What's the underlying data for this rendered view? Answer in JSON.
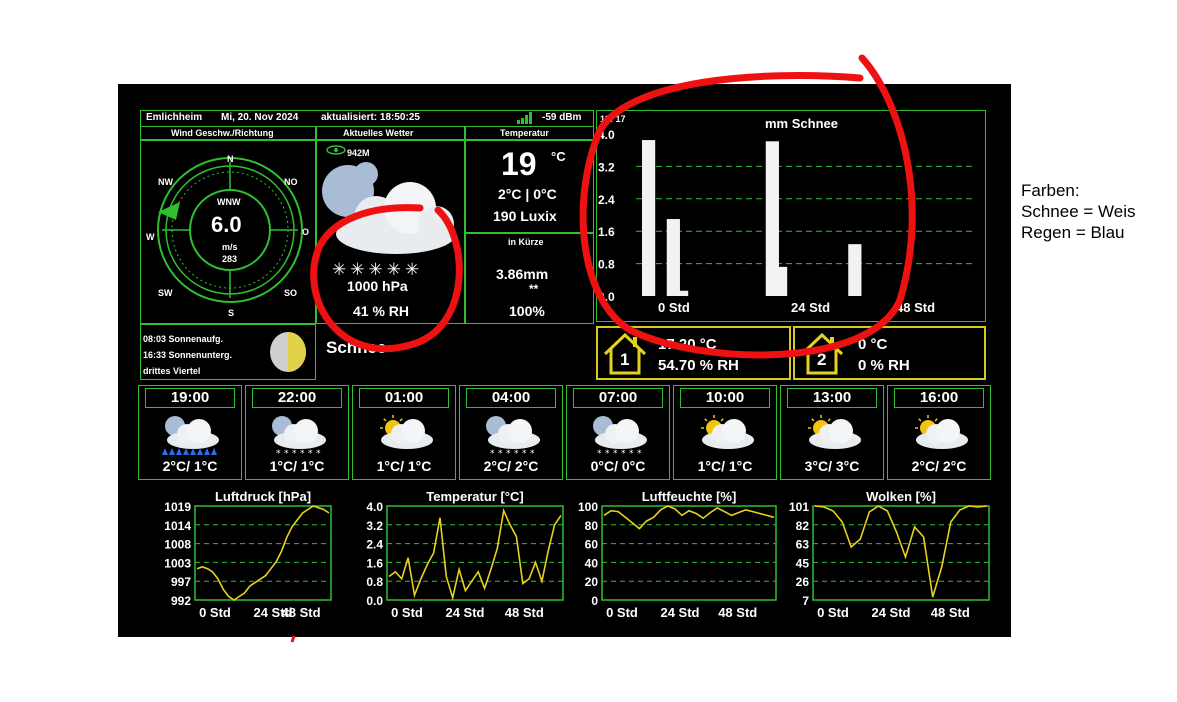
{
  "header": {
    "location": "Emlichheim",
    "date": "Mi, 20. Nov 2024",
    "updated": "aktualisiert: 18:50:25",
    "signal": "-59 dBm"
  },
  "wind": {
    "title": "Wind Geschw./Richtung",
    "n": "N",
    "no": "NO",
    "o": "O",
    "so": "SO",
    "s": "S",
    "sw": "SW",
    "w": "W",
    "nw": "NW",
    "dir": "WNW",
    "speed": "6.0",
    "unit": "m/s",
    "degrees": "283"
  },
  "current": {
    "title": "Aktuelles Wetter",
    "visibility": "942M",
    "snowflakes": "✳✳✳✳✳",
    "pressure": "1000 hPa",
    "humidity": "41 % RH",
    "condition": "Schnee"
  },
  "temperature": {
    "title": "Temperatur",
    "value": "19",
    "unit": "°C",
    "minmax": "2°C | 0°C",
    "lux": "190 Luxix"
  },
  "shortly": {
    "title": "in Kürze",
    "precip": "3.86mm",
    "symbol": "**",
    "probability": "100%"
  },
  "sun": {
    "sunrise": "08:03 Sonnenaufg.",
    "sunset": "16:33 Sonnenunterg.",
    "moon": "drittes Viertel"
  },
  "snow_chart_box": {
    "corner": "19:  17",
    "title": "mm Schnee"
  },
  "chart_data": [
    {
      "type": "bar",
      "title": "mm Schnee",
      "ylim": [
        0,
        4.0
      ],
      "yticks": [
        "4.0",
        "3.2",
        "2.4",
        "1.6",
        "0.8",
        "0.0"
      ],
      "xticks": [
        "0 Std",
        "24 Std",
        "48 Std"
      ],
      "values": [
        3.85,
        0,
        0,
        1.9,
        0.13,
        0,
        0,
        0,
        0,
        0,
        0,
        0,
        0,
        0,
        0,
        3.82,
        0.72,
        0,
        0,
        0,
        0,
        0,
        0,
        0,
        0,
        1.28,
        0,
        0,
        0,
        0,
        0,
        0,
        0,
        0,
        0,
        0,
        0,
        0,
        0,
        0
      ],
      "grid": true
    },
    {
      "type": "line",
      "title": "Luftdruck [hPa]",
      "yticks": [
        "1019",
        "1014",
        "1008",
        "1003",
        "997",
        "992"
      ],
      "ylim": [
        992,
        1019
      ],
      "xticks": [
        "0 Std",
        "24 Std",
        "48 Std"
      ],
      "values": [
        1001,
        1001.5,
        1001,
        1000,
        998,
        995,
        993,
        992,
        993,
        994,
        996,
        997,
        998,
        999,
        1001,
        1003,
        1006,
        1010,
        1013,
        1015,
        1017,
        1018,
        1019,
        1018.5,
        1018,
        1017
      ]
    },
    {
      "type": "line",
      "title": "Temperatur [°C]",
      "yticks": [
        "4.0",
        "3.2",
        "2.4",
        "1.6",
        "0.8",
        "0.0"
      ],
      "ylim": [
        0,
        4.0
      ],
      "xticks": [
        "0 Std",
        "24 Std",
        "48 Std"
      ],
      "values": [
        1.0,
        1.2,
        0.9,
        1.8,
        0.2,
        0.9,
        1.5,
        2.0,
        3.5,
        1.0,
        0.1,
        1.3,
        0.4,
        0.8,
        1.2,
        0.5,
        1.3,
        2.2,
        3.8,
        3.2,
        2.7,
        0.7,
        0.9,
        1.6,
        0.8,
        2.1,
        3.2,
        3.6
      ]
    },
    {
      "type": "line",
      "title": "Luftfeuchte [%]",
      "yticks": [
        "100",
        "80",
        "60",
        "40",
        "20",
        "0"
      ],
      "ylim": [
        0,
        100
      ],
      "xticks": [
        "0 Std",
        "24 Std",
        "48 Std"
      ],
      "values": [
        90,
        95,
        94,
        88,
        82,
        76,
        84,
        88,
        96,
        100,
        97,
        90,
        95,
        92,
        87,
        93,
        98,
        94,
        90,
        93,
        96,
        94,
        92,
        90,
        88
      ]
    },
    {
      "type": "line",
      "title": "Wolken [%]",
      "yticks": [
        "101",
        "82",
        "63",
        "45",
        "26",
        "7"
      ],
      "ylim": [
        7,
        101
      ],
      "xticks": [
        "0 Std",
        "24 Std",
        "48 Std"
      ],
      "values": [
        101,
        100,
        96,
        85,
        60,
        68,
        95,
        101,
        96,
        75,
        50,
        80,
        70,
        10,
        40,
        85,
        97,
        101,
        100,
        101
      ]
    }
  ],
  "indoor1": {
    "number": "1",
    "temp": "17.20 °C",
    "humidity": "54.70 % RH"
  },
  "indoor2": {
    "number": "2",
    "temp": "0 °C",
    "humidity": "0 % RH"
  },
  "forecast": [
    {
      "time": "19:00",
      "temp": "2°C/ 1°C",
      "icon": "rain-cloud-moon-icon"
    },
    {
      "time": "22:00",
      "temp": "1°C/ 1°C",
      "icon": "snow-cloud-moon-icon"
    },
    {
      "time": "01:00",
      "temp": "1°C/ 1°C",
      "icon": "cloud-sun-icon"
    },
    {
      "time": "04:00",
      "temp": "2°C/ 2°C",
      "icon": "snow-cloud-moon-icon"
    },
    {
      "time": "07:00",
      "temp": "0°C/ 0°C",
      "icon": "snow-cloud-moon-icon"
    },
    {
      "time": "10:00",
      "temp": "1°C/ 1°C",
      "icon": "cloud-sun-icon"
    },
    {
      "time": "13:00",
      "temp": "3°C/ 3°C",
      "icon": "cloud-sun-icon"
    },
    {
      "time": "16:00",
      "temp": "2°C/ 2°C",
      "icon": "cloud-sun-icon"
    }
  ],
  "annotation": {
    "line1": "Farben:",
    "line2": "Schnee = Weis",
    "line3": "Regen = Blau"
  },
  "colors": {
    "grid_green": "#2fbf2f",
    "line_yellow": "#e6d21e",
    "annotation_red": "#ee1111",
    "indoor_border": "#d7c81e"
  }
}
